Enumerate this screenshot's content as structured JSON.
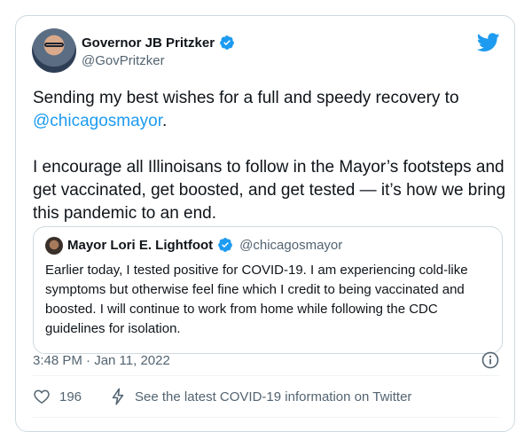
{
  "author": {
    "display_name": "Governor JB Pritzker",
    "handle": "@GovPritzker"
  },
  "tweet": {
    "line1_prefix": "Sending my best wishes for a full and speedy recovery to ",
    "mention": "@chicagosmayor",
    "line1_suffix": ".",
    "paragraph2": "I encourage all Illinoisans to follow in the Mayor’s footsteps and get vaccinated, get boosted, and get tested — it’s how we bring this pandemic to an end."
  },
  "quoted": {
    "display_name": "Mayor Lori E. Lightfoot",
    "handle": "@chicagosmayor",
    "text": "Earlier today, I tested positive for COVID-19. I am experiencing cold-like symptoms but otherwise feel fine which I credit to being vaccinated and boosted. I will continue to work from home while following the CDC guidelines for isolation."
  },
  "meta": {
    "timestamp": "3:48 PM · Jan 11, 2022"
  },
  "actions": {
    "like_count": "196",
    "covid_info_label": "See the latest COVID-19 information on Twitter"
  },
  "colors": {
    "accent": "#1d9bf0",
    "secondary_text": "#536471",
    "border": "#cfd9de"
  },
  "icons": [
    "verified-badge-icon",
    "twitter-bird-icon",
    "info-icon",
    "heart-icon",
    "lightning-bolt-icon"
  ]
}
